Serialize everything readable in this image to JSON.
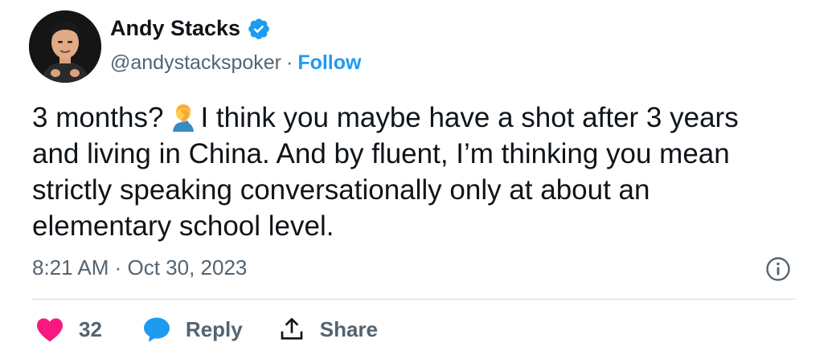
{
  "author": {
    "name": "Andy Stacks",
    "handle": "@andystackspoker",
    "separator": "·",
    "follow_label": "Follow"
  },
  "tweet": {
    "lines": [
      "3 months?",
      "I think you maybe have a shot after 3 years",
      "and living in China. And by fluent, I’m thinking you mean",
      "strictly speaking conversationally only at about an",
      "elementary school level."
    ],
    "emoji": "person-facepalming-emoji",
    "timestamp": "8:21 AM · Oct 30, 2023"
  },
  "actions": {
    "like_count": "32",
    "reply_label": "Reply",
    "share_label": "Share"
  },
  "colors": {
    "accent": "#1d9bf0",
    "like": "#f91880",
    "secondary_text": "#536471",
    "primary_text": "#0f1419",
    "divider": "#cfd9de"
  },
  "icons": [
    "verified-badge-icon",
    "info-icon",
    "heart-icon",
    "reply-bubble-icon",
    "share-icon"
  ]
}
